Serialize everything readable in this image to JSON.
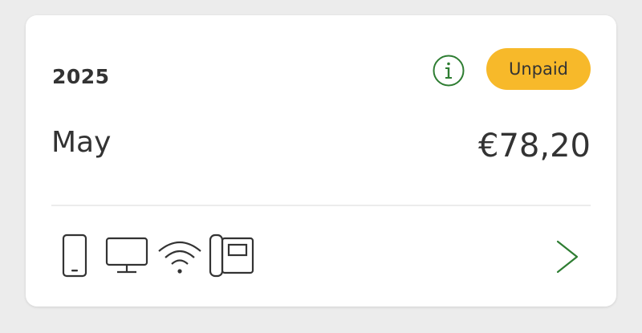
{
  "card": {
    "year": "2025",
    "status": "Unpaid",
    "month": "May",
    "amount": "€78,20"
  },
  "services": [
    {
      "icon": "mobile-phone-icon"
    },
    {
      "icon": "tv-icon"
    },
    {
      "icon": "wifi-icon"
    },
    {
      "icon": "landline-phone-icon"
    }
  ],
  "icons": {
    "info": "info-icon",
    "next": "chevron-right-icon"
  },
  "colors": {
    "background": "#ececec",
    "card": "#ffffff",
    "text": "#333333",
    "accent_green": "#2e7d32",
    "badge_yellow": "#f7b92a"
  }
}
